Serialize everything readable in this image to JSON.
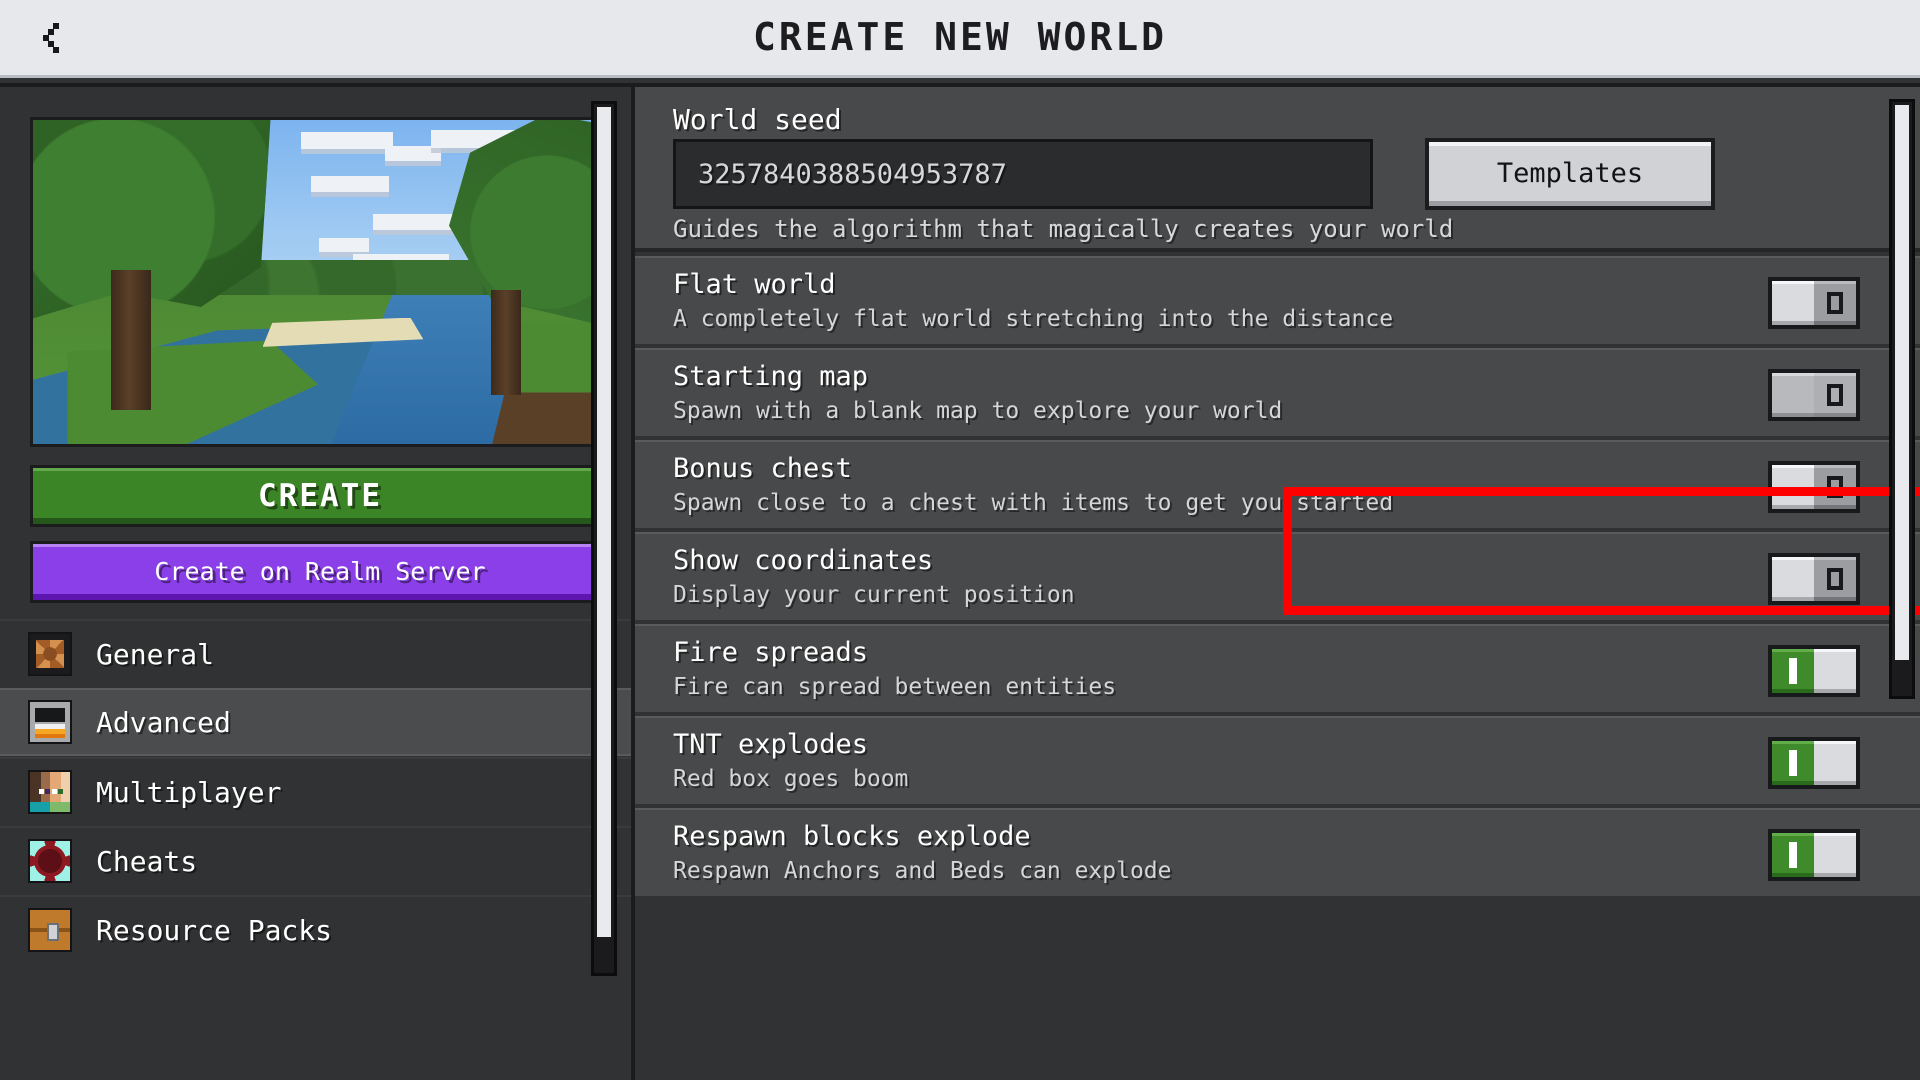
{
  "header": {
    "title": "CREATE NEW WORLD",
    "back_icon": "chevron-left-icon"
  },
  "left_panel": {
    "world_preview_alt": "minecraft-forest-river-preview",
    "create_button": "CREATE",
    "create_realm_button": "Create on Realm Server",
    "sidebar_items": [
      {
        "label": "General",
        "icon": "sunflower-icon",
        "selected": false
      },
      {
        "label": "Advanced",
        "icon": "furnace-icon",
        "selected": true
      },
      {
        "label": "Multiplayer",
        "icon": "two-players-icon",
        "selected": false
      },
      {
        "label": "Cheats",
        "icon": "beacon-icon",
        "selected": false
      },
      {
        "label": "Resource Packs",
        "icon": "chest-icon",
        "selected": false
      }
    ]
  },
  "right_panel": {
    "seed": {
      "label": "World seed",
      "value": "3257840388504953787",
      "placeholder": "World seed",
      "hint": "Guides the algorithm that magically creates your world",
      "templates_button": "Templates"
    },
    "settings": [
      {
        "title": "Flat world",
        "description": "A completely flat world stretching into the distance",
        "state": "off",
        "highlighted": false,
        "hovered": false
      },
      {
        "title": "Starting map",
        "description": "Spawn with a blank map to explore your world",
        "state": "off",
        "highlighted": true,
        "hovered": true
      },
      {
        "title": "Bonus chest",
        "description": "Spawn close to a chest with items to get you started",
        "state": "off",
        "highlighted": false,
        "hovered": false
      },
      {
        "title": "Show coordinates",
        "description": "Display your current position",
        "state": "off",
        "highlighted": false,
        "hovered": false
      },
      {
        "title": "Fire spreads",
        "description": "Fire can spread between entities",
        "state": "on",
        "highlighted": false,
        "hovered": false
      },
      {
        "title": "TNT explodes",
        "description": "Red box goes boom",
        "state": "on",
        "highlighted": false,
        "hovered": false
      },
      {
        "title": "Respawn blocks explode",
        "description": "Respawn Anchors and Beds can explode",
        "state": "on",
        "highlighted": false,
        "hovered": false
      }
    ]
  },
  "colors": {
    "header_bg": "#e6e8ec",
    "panel_bg": "#313233",
    "row_bg": "#48494a",
    "create_green": "#3c8527",
    "realm_purple": "#8b3fe8",
    "toggle_on_green": "#3f8b2c",
    "highlight_red": "#fe0000"
  },
  "toggle_glyphs": {
    "on": "I",
    "off": "O"
  }
}
